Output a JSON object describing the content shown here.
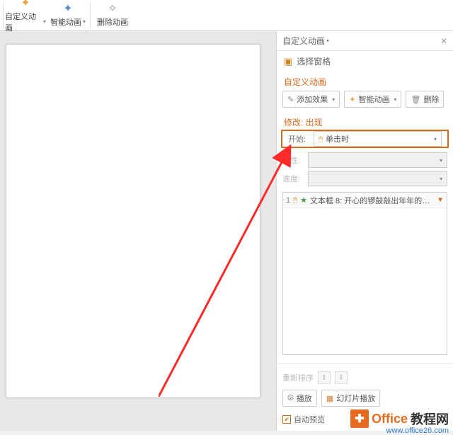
{
  "ribbon": {
    "custom_anim": "自定义动画",
    "smart_anim": "智能动画",
    "delete_anim": "删除动画"
  },
  "panel": {
    "title": "自定义动画",
    "select_pane": "选择窗格",
    "section_title": "自定义动画",
    "add_effect": "添加效果",
    "smart_anim": "智能动画",
    "delete": "删除",
    "modify_label": "修改: 出现",
    "start_label": "开始:",
    "start_value": "单击时",
    "prop_label": "属性:",
    "speed_label": "速度:",
    "list_item_num": "1",
    "list_item_text": "文本框 8: 开心的锣鼓敲出年年的…",
    "reorder_label": "重新排序",
    "play": "播放",
    "slideshow": "幻灯片播放",
    "auto_preview": "自动预览"
  },
  "watermark": {
    "t1": "Office",
    "t2": "教程网",
    "url": "www.office26.com"
  }
}
